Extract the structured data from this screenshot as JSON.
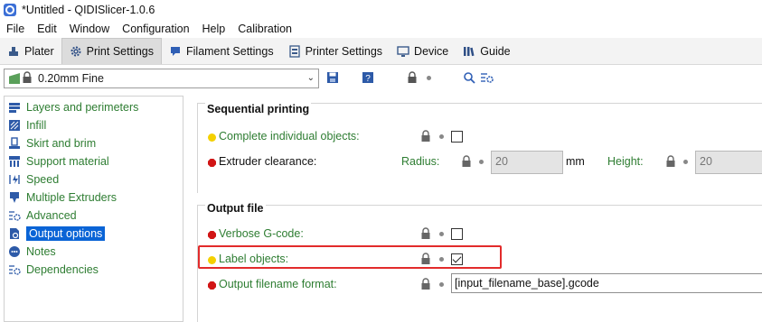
{
  "window": {
    "title": "*Untitled - QIDISlicer-1.0.6"
  },
  "menu": [
    "File",
    "Edit",
    "Window",
    "Configuration",
    "Help",
    "Calibration"
  ],
  "tabs": [
    {
      "label": "Plater",
      "icon": "plater-icon",
      "active": false
    },
    {
      "label": "Print Settings",
      "icon": "gear-icon",
      "active": true
    },
    {
      "label": "Filament Settings",
      "icon": "filament-icon",
      "active": false
    },
    {
      "label": "Printer Settings",
      "icon": "printer-icon",
      "active": false
    },
    {
      "label": "Device",
      "icon": "device-icon",
      "active": false
    },
    {
      "label": "Guide",
      "icon": "guide-icon",
      "active": false
    }
  ],
  "preset": {
    "value": "0.20mm Fine"
  },
  "sidebar": {
    "items": [
      {
        "label": "Layers and perimeters",
        "icon": "layers-icon",
        "selected": false
      },
      {
        "label": "Infill",
        "icon": "infill-icon",
        "selected": false
      },
      {
        "label": "Skirt and brim",
        "icon": "skirt-icon",
        "selected": false
      },
      {
        "label": "Support material",
        "icon": "support-icon",
        "selected": false
      },
      {
        "label": "Speed",
        "icon": "speed-icon",
        "selected": false
      },
      {
        "label": "Multiple Extruders",
        "icon": "extruder-icon",
        "selected": false
      },
      {
        "label": "Advanced",
        "icon": "advanced-icon",
        "selected": false
      },
      {
        "label": "Output options",
        "icon": "output-icon",
        "selected": true
      },
      {
        "label": "Notes",
        "icon": "notes-icon",
        "selected": false
      },
      {
        "label": "Dependencies",
        "icon": "dependencies-icon",
        "selected": false
      }
    ]
  },
  "sequential": {
    "title": "Sequential printing",
    "complete_label": "Complete individual objects:",
    "complete_checked": false,
    "clearance_label": "Extruder clearance:",
    "radius_label": "Radius:",
    "radius_value": "20",
    "radius_unit": "mm",
    "height_label": "Height:",
    "height_value": "20"
  },
  "output": {
    "title": "Output file",
    "verbose_label": "Verbose G-code:",
    "verbose_checked": false,
    "label_objects_label": "Label objects:",
    "label_objects_checked": true,
    "filename_label": "Output filename format:",
    "filename_value": "[input_filename_base].gcode"
  },
  "colors": {
    "accent_green": "#2e7d32",
    "highlight_red": "#e22b2b",
    "selected_blue": "#0a64d6",
    "bullet_yellow": "#f4d000",
    "bullet_red": "#d11515"
  }
}
